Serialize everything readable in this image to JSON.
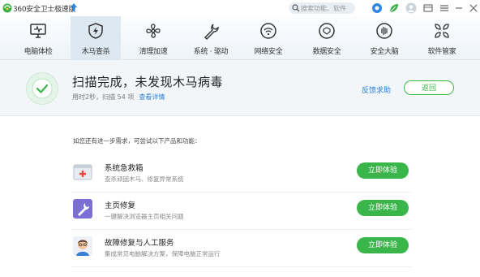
{
  "app": {
    "title": "360安全卫士极速版",
    "search_placeholder": "搜索功能、软件"
  },
  "nav": {
    "items": [
      {
        "label": "电脑体检",
        "icon": "monitor-icon",
        "active": false
      },
      {
        "label": "木马查杀",
        "icon": "shield-bolt-icon",
        "active": true
      },
      {
        "label": "清理加速",
        "icon": "fan-icon",
        "active": false
      },
      {
        "label": "系统 · 驱动",
        "icon": "wrench-icon",
        "active": false
      },
      {
        "label": "网络安全",
        "icon": "wifi-icon",
        "active": false
      },
      {
        "label": "数据安全",
        "icon": "shield-check-icon",
        "active": false
      },
      {
        "label": "安全大脑",
        "icon": "brain-icon",
        "active": false
      },
      {
        "label": "软件管家",
        "icon": "apps-icon",
        "active": false
      }
    ]
  },
  "result": {
    "title": "扫描完成，未发现木马病毒",
    "subtitle": "用时2秒，扫描 54 项",
    "detail_link": "查看详情",
    "help_link": "反馈求助",
    "back_button": "返回"
  },
  "products": {
    "hint": "如您还有进一步需求，可尝试以下产品和功能：",
    "items": [
      {
        "name": "系统急救箱",
        "desc": "查杀顽固木马、修复异常系统",
        "button": "立即体验",
        "icon": "first-aid-kit-icon"
      },
      {
        "name": "主页修复",
        "desc": "一键解决浏览器主页相关问题",
        "button": "立即体验",
        "icon": "wrench-repair-icon"
      },
      {
        "name": "故障修复与人工服务",
        "desc": "集成常见电脑解决方案，保障电脑正常运行",
        "button": "立即体验",
        "icon": "support-agent-icon"
      }
    ]
  },
  "colors": {
    "accent_green": "#39b54a",
    "link_blue": "#2a7fd4",
    "nav_active": "#dde8f1"
  }
}
